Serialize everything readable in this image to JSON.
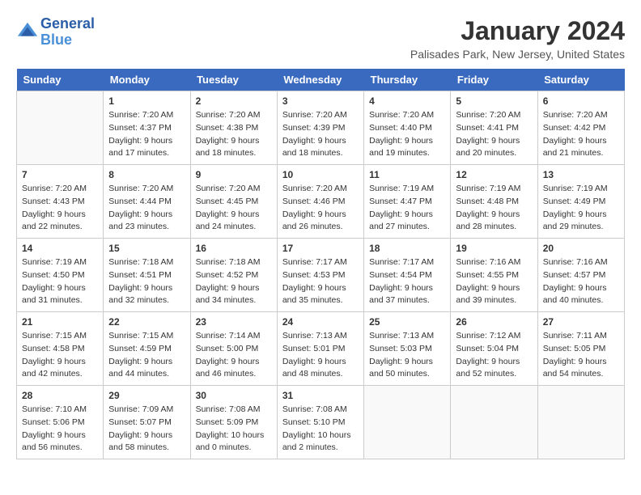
{
  "header": {
    "logo_line1": "General",
    "logo_line2": "Blue",
    "title": "January 2024",
    "subtitle": "Palisades Park, New Jersey, United States"
  },
  "days_of_week": [
    "Sunday",
    "Monday",
    "Tuesday",
    "Wednesday",
    "Thursday",
    "Friday",
    "Saturday"
  ],
  "weeks": [
    [
      {
        "day": "",
        "sunrise": "",
        "sunset": "",
        "daylight": "",
        "empty": true
      },
      {
        "day": "1",
        "sunrise": "Sunrise: 7:20 AM",
        "sunset": "Sunset: 4:37 PM",
        "daylight": "Daylight: 9 hours and 17 minutes."
      },
      {
        "day": "2",
        "sunrise": "Sunrise: 7:20 AM",
        "sunset": "Sunset: 4:38 PM",
        "daylight": "Daylight: 9 hours and 18 minutes."
      },
      {
        "day": "3",
        "sunrise": "Sunrise: 7:20 AM",
        "sunset": "Sunset: 4:39 PM",
        "daylight": "Daylight: 9 hours and 18 minutes."
      },
      {
        "day": "4",
        "sunrise": "Sunrise: 7:20 AM",
        "sunset": "Sunset: 4:40 PM",
        "daylight": "Daylight: 9 hours and 19 minutes."
      },
      {
        "day": "5",
        "sunrise": "Sunrise: 7:20 AM",
        "sunset": "Sunset: 4:41 PM",
        "daylight": "Daylight: 9 hours and 20 minutes."
      },
      {
        "day": "6",
        "sunrise": "Sunrise: 7:20 AM",
        "sunset": "Sunset: 4:42 PM",
        "daylight": "Daylight: 9 hours and 21 minutes."
      }
    ],
    [
      {
        "day": "7",
        "sunrise": "Sunrise: 7:20 AM",
        "sunset": "Sunset: 4:43 PM",
        "daylight": "Daylight: 9 hours and 22 minutes."
      },
      {
        "day": "8",
        "sunrise": "Sunrise: 7:20 AM",
        "sunset": "Sunset: 4:44 PM",
        "daylight": "Daylight: 9 hours and 23 minutes."
      },
      {
        "day": "9",
        "sunrise": "Sunrise: 7:20 AM",
        "sunset": "Sunset: 4:45 PM",
        "daylight": "Daylight: 9 hours and 24 minutes."
      },
      {
        "day": "10",
        "sunrise": "Sunrise: 7:20 AM",
        "sunset": "Sunset: 4:46 PM",
        "daylight": "Daylight: 9 hours and 26 minutes."
      },
      {
        "day": "11",
        "sunrise": "Sunrise: 7:19 AM",
        "sunset": "Sunset: 4:47 PM",
        "daylight": "Daylight: 9 hours and 27 minutes."
      },
      {
        "day": "12",
        "sunrise": "Sunrise: 7:19 AM",
        "sunset": "Sunset: 4:48 PM",
        "daylight": "Daylight: 9 hours and 28 minutes."
      },
      {
        "day": "13",
        "sunrise": "Sunrise: 7:19 AM",
        "sunset": "Sunset: 4:49 PM",
        "daylight": "Daylight: 9 hours and 29 minutes."
      }
    ],
    [
      {
        "day": "14",
        "sunrise": "Sunrise: 7:19 AM",
        "sunset": "Sunset: 4:50 PM",
        "daylight": "Daylight: 9 hours and 31 minutes."
      },
      {
        "day": "15",
        "sunrise": "Sunrise: 7:18 AM",
        "sunset": "Sunset: 4:51 PM",
        "daylight": "Daylight: 9 hours and 32 minutes."
      },
      {
        "day": "16",
        "sunrise": "Sunrise: 7:18 AM",
        "sunset": "Sunset: 4:52 PM",
        "daylight": "Daylight: 9 hours and 34 minutes."
      },
      {
        "day": "17",
        "sunrise": "Sunrise: 7:17 AM",
        "sunset": "Sunset: 4:53 PM",
        "daylight": "Daylight: 9 hours and 35 minutes."
      },
      {
        "day": "18",
        "sunrise": "Sunrise: 7:17 AM",
        "sunset": "Sunset: 4:54 PM",
        "daylight": "Daylight: 9 hours and 37 minutes."
      },
      {
        "day": "19",
        "sunrise": "Sunrise: 7:16 AM",
        "sunset": "Sunset: 4:55 PM",
        "daylight": "Daylight: 9 hours and 39 minutes."
      },
      {
        "day": "20",
        "sunrise": "Sunrise: 7:16 AM",
        "sunset": "Sunset: 4:57 PM",
        "daylight": "Daylight: 9 hours and 40 minutes."
      }
    ],
    [
      {
        "day": "21",
        "sunrise": "Sunrise: 7:15 AM",
        "sunset": "Sunset: 4:58 PM",
        "daylight": "Daylight: 9 hours and 42 minutes."
      },
      {
        "day": "22",
        "sunrise": "Sunrise: 7:15 AM",
        "sunset": "Sunset: 4:59 PM",
        "daylight": "Daylight: 9 hours and 44 minutes."
      },
      {
        "day": "23",
        "sunrise": "Sunrise: 7:14 AM",
        "sunset": "Sunset: 5:00 PM",
        "daylight": "Daylight: 9 hours and 46 minutes."
      },
      {
        "day": "24",
        "sunrise": "Sunrise: 7:13 AM",
        "sunset": "Sunset: 5:01 PM",
        "daylight": "Daylight: 9 hours and 48 minutes."
      },
      {
        "day": "25",
        "sunrise": "Sunrise: 7:13 AM",
        "sunset": "Sunset: 5:03 PM",
        "daylight": "Daylight: 9 hours and 50 minutes."
      },
      {
        "day": "26",
        "sunrise": "Sunrise: 7:12 AM",
        "sunset": "Sunset: 5:04 PM",
        "daylight": "Daylight: 9 hours and 52 minutes."
      },
      {
        "day": "27",
        "sunrise": "Sunrise: 7:11 AM",
        "sunset": "Sunset: 5:05 PM",
        "daylight": "Daylight: 9 hours and 54 minutes."
      }
    ],
    [
      {
        "day": "28",
        "sunrise": "Sunrise: 7:10 AM",
        "sunset": "Sunset: 5:06 PM",
        "daylight": "Daylight: 9 hours and 56 minutes."
      },
      {
        "day": "29",
        "sunrise": "Sunrise: 7:09 AM",
        "sunset": "Sunset: 5:07 PM",
        "daylight": "Daylight: 9 hours and 58 minutes."
      },
      {
        "day": "30",
        "sunrise": "Sunrise: 7:08 AM",
        "sunset": "Sunset: 5:09 PM",
        "daylight": "Daylight: 10 hours and 0 minutes."
      },
      {
        "day": "31",
        "sunrise": "Sunrise: 7:08 AM",
        "sunset": "Sunset: 5:10 PM",
        "daylight": "Daylight: 10 hours and 2 minutes."
      },
      {
        "day": "",
        "sunrise": "",
        "sunset": "",
        "daylight": "",
        "empty": true
      },
      {
        "day": "",
        "sunrise": "",
        "sunset": "",
        "daylight": "",
        "empty": true
      },
      {
        "day": "",
        "sunrise": "",
        "sunset": "",
        "daylight": "",
        "empty": true
      }
    ]
  ]
}
